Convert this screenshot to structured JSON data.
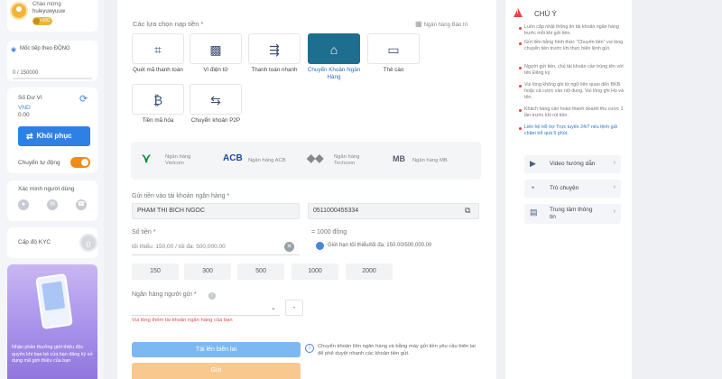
{
  "user": {
    "greeting": "Chào mừng",
    "username": "huleyuwyuuw",
    "vip_badge": ">100"
  },
  "level": {
    "title": "Mốc tiếp theo ĐỘNG",
    "progress": "0 / 150000",
    "progress_fraction": 0
  },
  "balance": {
    "label": "Số Dư Ví",
    "currency": "VND",
    "value": "0.00",
    "restore_label": "Khôi phục",
    "auto_transfer_label": "Chuyển tự động",
    "auto_transfer_on": true
  },
  "verify": {
    "title": "Xác minh người dùng"
  },
  "kyc": {
    "label": "Cấp độ KYC",
    "level": "0"
  },
  "promo": {
    "text": "Nhận phần thưởng giới thiệu độc quyền khi bạn bè của bạn đăng ký sử dụng mã giới thiệu của bạn"
  },
  "deposit": {
    "options_title": "Các lựa chọn nạp tiền *",
    "bank_info_link": "Ngân hàng Bảo trì",
    "methods": [
      {
        "label": "Quét mã thanh toán",
        "icon": "qr-scan-icon",
        "active": false
      },
      {
        "label": "Ví điện tử",
        "icon": "qr-code-icon",
        "active": false
      },
      {
        "label": "Thanh toán nhanh",
        "icon": "fast-payment-icon",
        "active": false
      },
      {
        "label": "Chuyển Khoản Ngân Hàng",
        "icon": "bank-icon",
        "active": true
      },
      {
        "label": "Thẻ cào",
        "icon": "card-icon",
        "active": false
      },
      {
        "label": "Tiền mã hóa",
        "icon": "crypto-icon",
        "active": false
      },
      {
        "label": "Chuyển khoản P2P",
        "icon": "p2p-icon",
        "active": false
      }
    ],
    "banks": [
      {
        "logo": "Vietcombank",
        "name": "Ngân hàng Vietcom",
        "color": "#0a8a3a"
      },
      {
        "logo": "ACB",
        "name": "Ngân hàng ACB",
        "color": "#1b4aa0"
      },
      {
        "logo": "Techcombank",
        "name": "Ngân hàng Techcom",
        "color": "#777777"
      },
      {
        "logo": "MB",
        "name": "Ngân hàng MB",
        "color": "#556070"
      }
    ],
    "account_label": "Gửi tiền vào tài khoản ngân hàng *",
    "account_name": "PHAM THI BICH NGOC",
    "account_number": "0511000455334",
    "amount_label": "Số tiền *",
    "rate_text": "= 1000 đồng",
    "amount_placeholder": "tối thiểu: 150,00 / tối đa: 500,000.00",
    "limit_text": "Giới hạn tối thiểu/tối đa: 150.00/500,000.00",
    "quick_amounts": [
      "150",
      "300",
      "500",
      "1000",
      "2000"
    ],
    "sender_bank_label": "Ngân hàng người gửi *",
    "dash": "-",
    "error_text": "Vui lòng thêm tài khoản ngân hàng của bạn",
    "edit_btn": "Tải lên biên lai",
    "send_btn": "Gửi",
    "note_text": "Chuyển khoản liên ngân hàng và bằng máy gửi tiền yêu cầu biên lai để phê duyệt nhanh các khoản tiền gửi."
  },
  "notes": {
    "title": "CHÚ Ý",
    "items": [
      "Luôn cập nhật thông tin tài khoản ngân hàng trước mỗi khi gửi tiền.",
      "Gửi tiền bằng hình thức \"Chuyển tiền\" vui lòng chuyển tiền trước khi thực hiện lệnh gửi.",
      "Người gửi tiền, chủ tài khoản cần trùng tên với tên Đăng ký.",
      "Vui lòng không ghi từ ngữ liên quan đến BKB hoặc cá cược vào nội dung. Vui lòng ghi Họ và tên.",
      "Khách hàng cần hoàn thành doanh thu cược 1 lần trước khi rút tiền.",
      "Liên hệ Hỗ trợ Trực tuyến 24/7 nếu lệnh gửi chậm trễ quá 5 phút."
    ],
    "links": [
      {
        "label": "Video hướng dẫn",
        "icon": "video-icon"
      },
      {
        "label": "Trò chuyện",
        "icon": "chat-icon"
      },
      {
        "label": "Trung tâm thông tin",
        "icon": "info-center-icon"
      }
    ]
  }
}
